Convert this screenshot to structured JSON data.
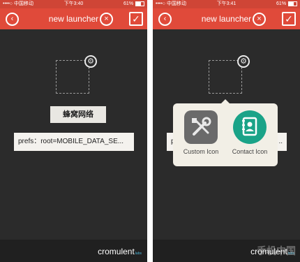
{
  "left_screen": {
    "status": {
      "carrier": "••••○ 中国移动",
      "time": "下午3:40",
      "battery": "61%"
    },
    "nav": {
      "title": "new launcher"
    },
    "label_text": "蜂窝网络",
    "prefs_value": "prefs：root=MOBILE_DATA_SE...",
    "brand": "cromulent",
    "brand_tag": "labs"
  },
  "right_screen": {
    "status": {
      "carrier": "••••○ 中国移动",
      "time": "下午3:41",
      "battery": "61%"
    },
    "nav": {
      "title": "new launcher"
    },
    "prefs_left": "p",
    "prefs_right": "..",
    "popup": {
      "custom_label": "Custom Icon",
      "contact_label": "Contact Icon"
    },
    "brand": "cromulent",
    "brand_tag": "labs"
  },
  "watermark": "手机中国"
}
